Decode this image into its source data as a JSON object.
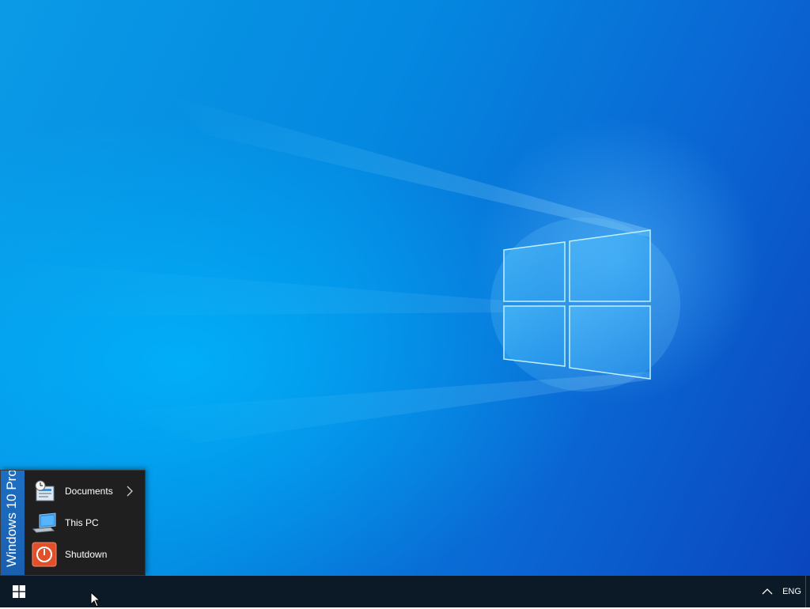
{
  "start_menu": {
    "banner_text": "Windows 10 Pro",
    "items": [
      {
        "label": "Documents",
        "icon": "documents-icon",
        "has_submenu": true
      },
      {
        "label": "This PC",
        "icon": "computer-icon",
        "has_submenu": false
      },
      {
        "label": "Shutdown",
        "icon": "power-icon",
        "has_submenu": false
      }
    ]
  },
  "taskbar": {
    "language": "ENG",
    "start_icon": "windows-logo-icon",
    "tray_icon": "chevron-up-icon"
  },
  "colors": {
    "desktop_blue": "#0a8fe2",
    "taskbar_bg": "#0b1a26",
    "menu_bg": "#1f1f1f",
    "banner_blue": "#1d6fc2",
    "shutdown_red": "#e0502a"
  }
}
